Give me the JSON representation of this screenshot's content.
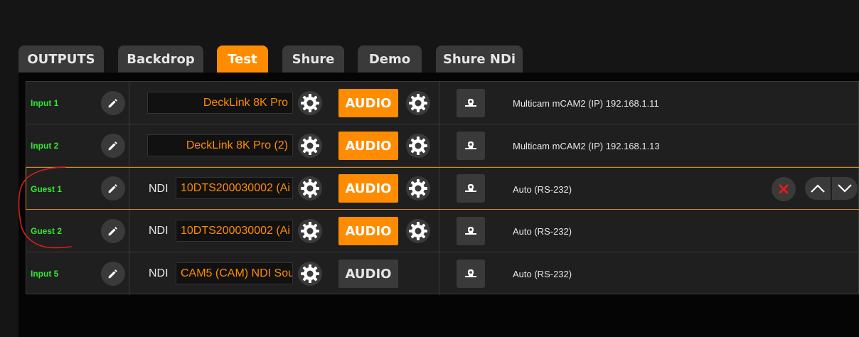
{
  "tabs": [
    {
      "label": "OUTPUTS",
      "active": false
    },
    {
      "label": "Backdrop",
      "active": false
    },
    {
      "label": "Test",
      "active": true
    },
    {
      "label": "Shure",
      "active": false
    },
    {
      "label": "Demo",
      "active": false
    },
    {
      "label": "Shure NDi",
      "active": false
    }
  ],
  "rows": [
    {
      "name": "Input 1",
      "source_type": "",
      "source": "DeckLink 8K Pro",
      "audio_label": "AUDIO",
      "audio_active": true,
      "info": "Multicam mCAM2 (IP) 192.168.1.11"
    },
    {
      "name": "Input 2",
      "source_type": "",
      "source": "DeckLink 8K Pro (2)",
      "audio_label": "AUDIO",
      "audio_active": true,
      "info": "Multicam mCAM2 (IP) 192.168.1.13"
    },
    {
      "name": "Guest 1",
      "source_type": "NDI",
      "source": "10DTS200030002 (Ai",
      "audio_label": "AUDIO",
      "audio_active": true,
      "info": "Auto (RS-232)"
    },
    {
      "name": "Guest 2",
      "source_type": "NDI",
      "source": "10DTS200030002 (Ai",
      "audio_label": "AUDIO",
      "audio_active": true,
      "info": "Auto (RS-232)"
    },
    {
      "name": "Input 5",
      "source_type": "NDI",
      "source": "CAM5 (CAM) NDI Sou",
      "audio_label": "AUDIO",
      "audio_active": false,
      "info": "Auto (RS-232)"
    }
  ],
  "colors": {
    "accent": "#ff8c00",
    "name_green": "#33e633",
    "remove_red": "#e31b1b",
    "annotation_red": "#d42020"
  },
  "icons": [
    "pencil-icon",
    "gear-icon",
    "camera-control-icon",
    "close-icon",
    "chevron-up-icon",
    "chevron-down-icon"
  ]
}
